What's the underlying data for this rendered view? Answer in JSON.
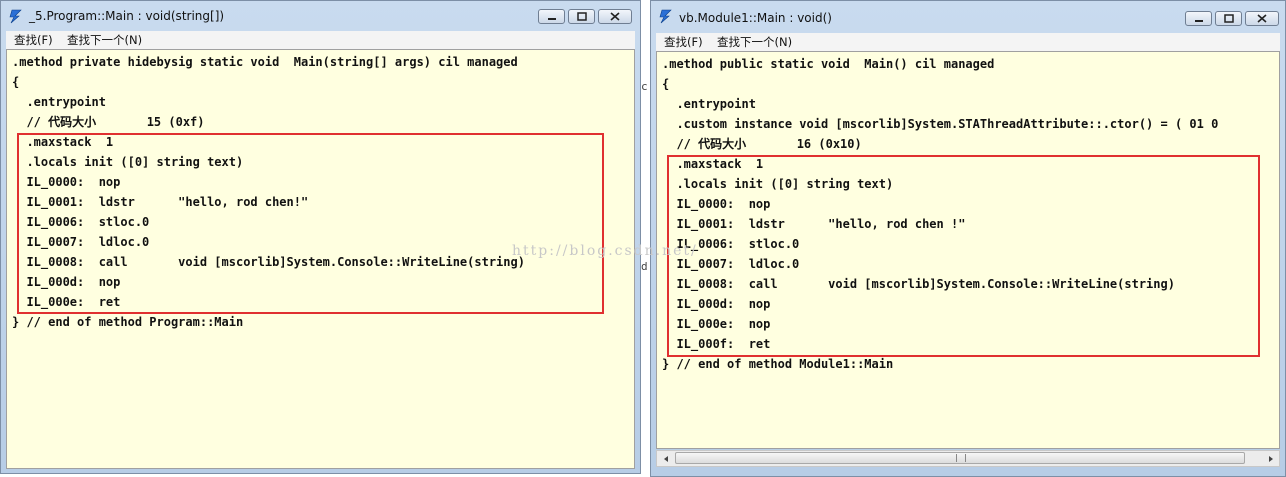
{
  "left": {
    "title": "_5.Program::Main : void(string[])",
    "menu": [
      "查找(F)",
      "查找下一个(N)"
    ],
    "lines": [
      ".method private hidebysig static void  Main(string[] args) cil managed",
      "{",
      "  .entrypoint",
      "  // 代码大小       15 (0xf)",
      "  .maxstack  1",
      "  .locals init ([0] string text)",
      "  IL_0000:  nop",
      "  IL_0001:  ldstr      \"hello, rod chen!\"",
      "  IL_0006:  stloc.0",
      "  IL_0007:  ldloc.0",
      "  IL_0008:  call       void [mscorlib]System.Console::WriteLine(string)",
      "  IL_000d:  nop",
      "  IL_000e:  ret",
      "} // end of method Program::Main"
    ]
  },
  "right": {
    "title": "vb.Module1::Main : void()",
    "menu": [
      "查找(F)",
      "查找下一个(N)"
    ],
    "lines": [
      ".method public static void  Main() cil managed",
      "{",
      "  .entrypoint",
      "  .custom instance void [mscorlib]System.STAThreadAttribute::.ctor() = ( 01 0",
      "  // 代码大小       16 (0x10)",
      "  .maxstack  1",
      "  .locals init ([0] string text)",
      "  IL_0000:  nop",
      "  IL_0001:  ldstr      \"hello, rod chen !\"",
      "  IL_0006:  stloc.0",
      "  IL_0007:  ldloc.0",
      "  IL_0008:  call       void [mscorlib]System.Console::WriteLine(string)",
      "  IL_000d:  nop",
      "  IL_000e:  nop",
      "  IL_000f:  ret",
      "} // end of method Module1::Main"
    ]
  },
  "background": {
    "watermark": "http://blog.csdn.net/",
    "glyphs": [
      "c",
      "d"
    ]
  },
  "colors": {
    "highlight": "#e03030",
    "code_bg": "#ffffe0"
  },
  "icons": [
    "app-icon",
    "minimize-icon",
    "maximize-icon",
    "close-icon",
    "scroll-left-icon",
    "scroll-right-icon"
  ]
}
